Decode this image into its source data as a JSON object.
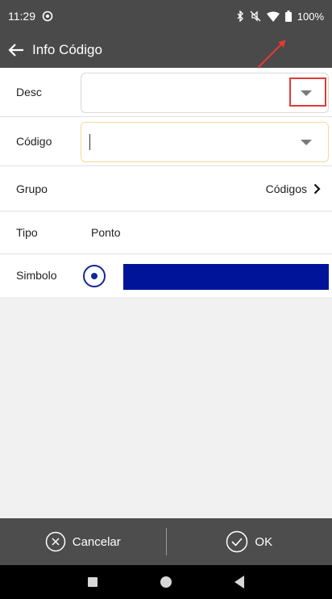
{
  "status_bar": {
    "time": "11:29",
    "battery": "100%",
    "icons": [
      "sync-icon",
      "bluetooth-icon",
      "mute-icon",
      "wifi-icon",
      "battery-icon"
    ]
  },
  "app_bar": {
    "title": "Info Código",
    "back_icon": "arrow-left-icon"
  },
  "form": {
    "desc": {
      "label": "Desc",
      "value": ""
    },
    "codigo": {
      "label": "Código",
      "value": ""
    },
    "grupo": {
      "label": "Grupo",
      "value": "Códigos"
    },
    "tipo": {
      "label": "Tipo",
      "value": "Ponto"
    },
    "simbolo": {
      "label": "Simbolo",
      "color": "#00149A"
    }
  },
  "annotation": {
    "color": "#E53935"
  },
  "bottom_bar": {
    "cancel_label": "Cancelar",
    "ok_label": "OK"
  },
  "colors": {
    "toolbar": "#4A4A4A",
    "accent": "#12289A"
  }
}
